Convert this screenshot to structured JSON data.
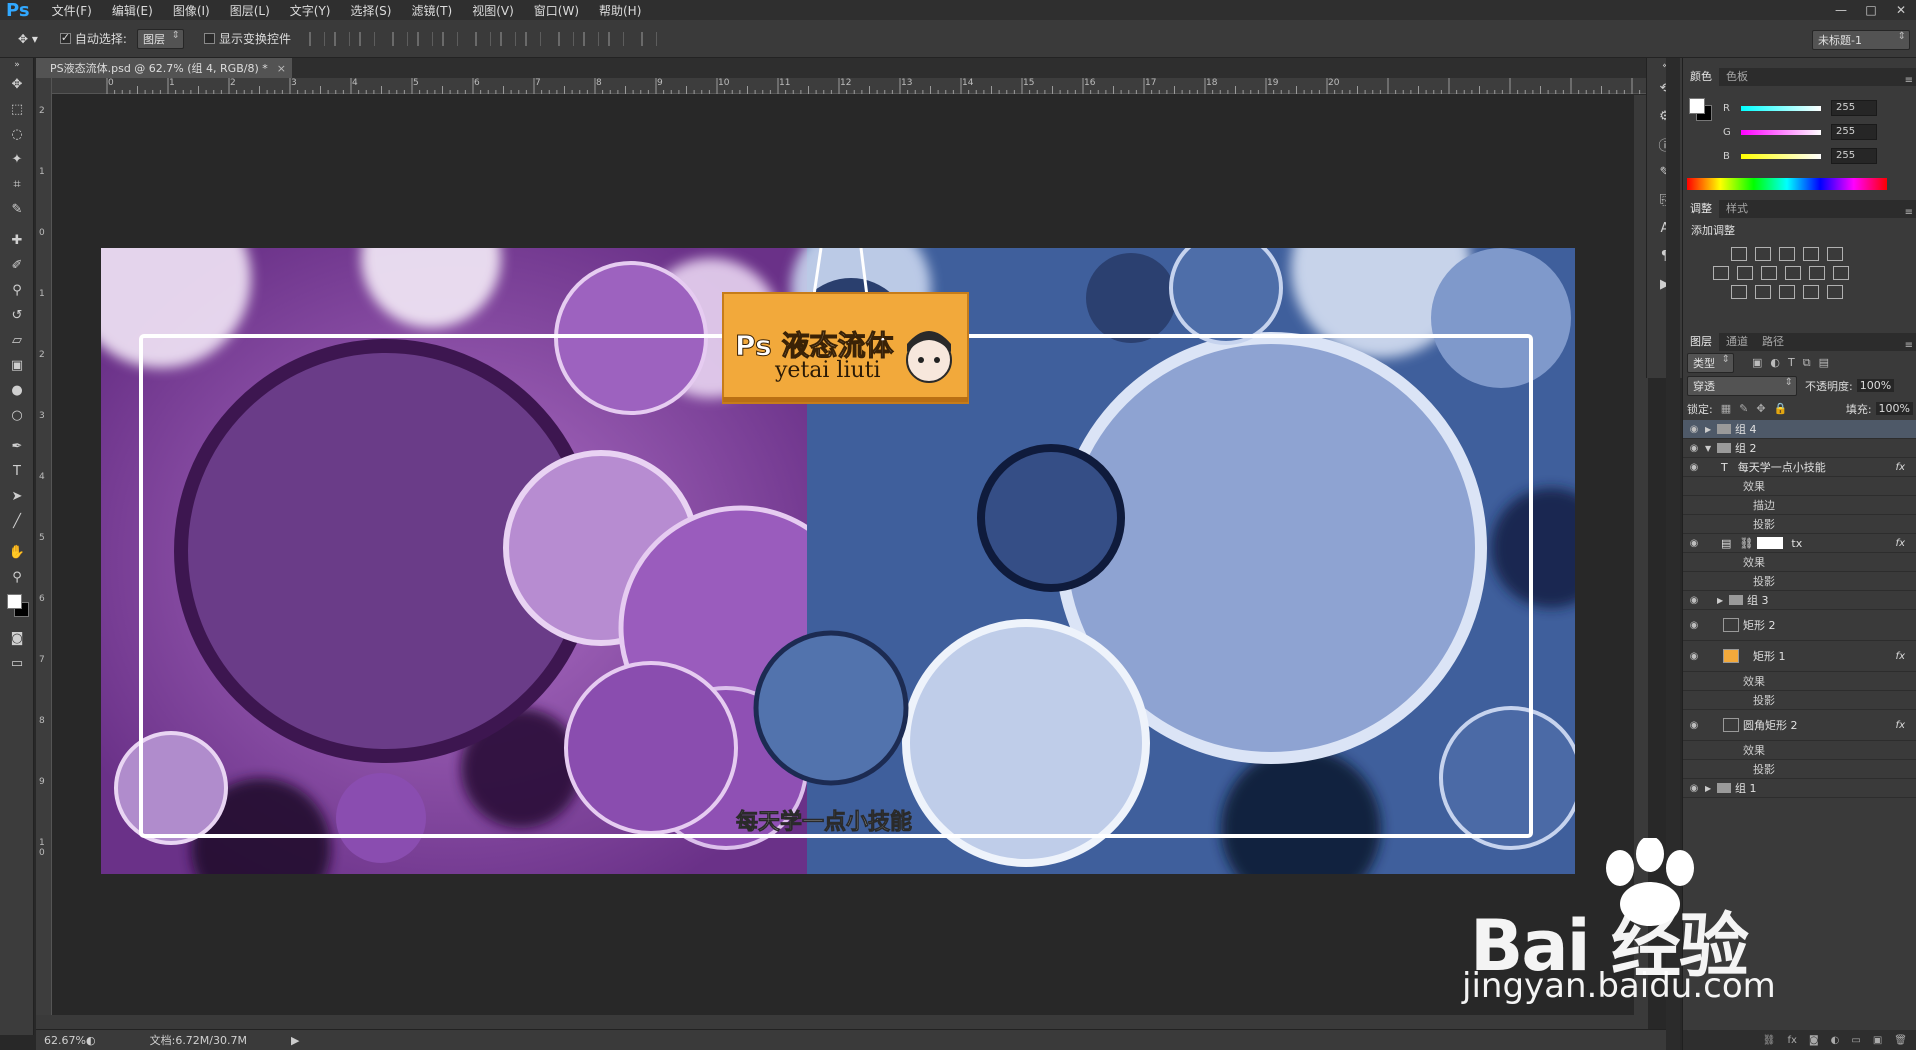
{
  "app": {
    "logo": "Ps"
  },
  "menu": [
    "文件(F)",
    "编辑(E)",
    "图像(I)",
    "图层(L)",
    "文字(Y)",
    "选择(S)",
    "滤镜(T)",
    "视图(V)",
    "窗口(W)",
    "帮助(H)"
  ],
  "options": {
    "auto_select_label": "自动选择:",
    "auto_select_value": "图层",
    "show_transform_label": "显示变换控件",
    "workspace": "未标题-1"
  },
  "document": {
    "tab_title": "PS液态流体.psd @ 62.7% (组 4, RGB/8) *",
    "close": "×",
    "zoom": "62.67%",
    "doc_size": "文档:6.72M/30.7M"
  },
  "ruler_h": [
    "0",
    "1",
    "2",
    "3",
    "4",
    "5",
    "6",
    "7",
    "8",
    "9",
    "10",
    "11",
    "12",
    "13",
    "14",
    "15",
    "16",
    "17",
    "18",
    "19",
    "20"
  ],
  "ruler_v": [
    "2",
    "1",
    "0",
    "1",
    "2",
    "3",
    "4",
    "5",
    "6",
    "7",
    "8",
    "9",
    "1 0"
  ],
  "artwork": {
    "title_line1": "Ps 液态流体",
    "title_line2": "yetai liuti",
    "caption": "每天学一点小技能"
  },
  "color_panel": {
    "tabs": [
      "颜色",
      "色板"
    ],
    "r_label": "R",
    "r_value": "255",
    "g_label": "G",
    "g_value": "255",
    "b_label": "B",
    "b_value": "255"
  },
  "adjust_panel": {
    "tabs": [
      "调整",
      "样式"
    ],
    "title": "添加调整"
  },
  "layers_panel": {
    "tabs": [
      "图层",
      "通道",
      "路径"
    ],
    "filter_kind": "类型",
    "blend_mode": "穿透",
    "opacity_label": "不透明度:",
    "opacity_value": "100%",
    "lock_label": "锁定:",
    "fill_label": "填充:",
    "fill_value": "100%",
    "layers": [
      {
        "name": "组 4"
      },
      {
        "name": "组 2"
      },
      {
        "name": "每天学一点小技能"
      },
      {
        "name": "效果"
      },
      {
        "name": "描边"
      },
      {
        "name": "投影"
      },
      {
        "name": "tx"
      },
      {
        "name": "效果"
      },
      {
        "name": "投影"
      },
      {
        "name": "组 3"
      },
      {
        "name": "矩形 2"
      },
      {
        "name": "矩形 1"
      },
      {
        "name": "效果"
      },
      {
        "name": "投影"
      },
      {
        "name": "圆角矩形 2"
      },
      {
        "name": "效果"
      },
      {
        "name": "投影"
      },
      {
        "name": "组 1"
      }
    ],
    "fx": "fx"
  },
  "watermark": {
    "brand": "Bai 经验",
    "url": "jingyan.baidu.com"
  },
  "colors": {
    "purple": "#7a3f9b",
    "blue": "#4b6aa6",
    "label_bg": "#f2a93b",
    "selection": "#4e5968"
  }
}
